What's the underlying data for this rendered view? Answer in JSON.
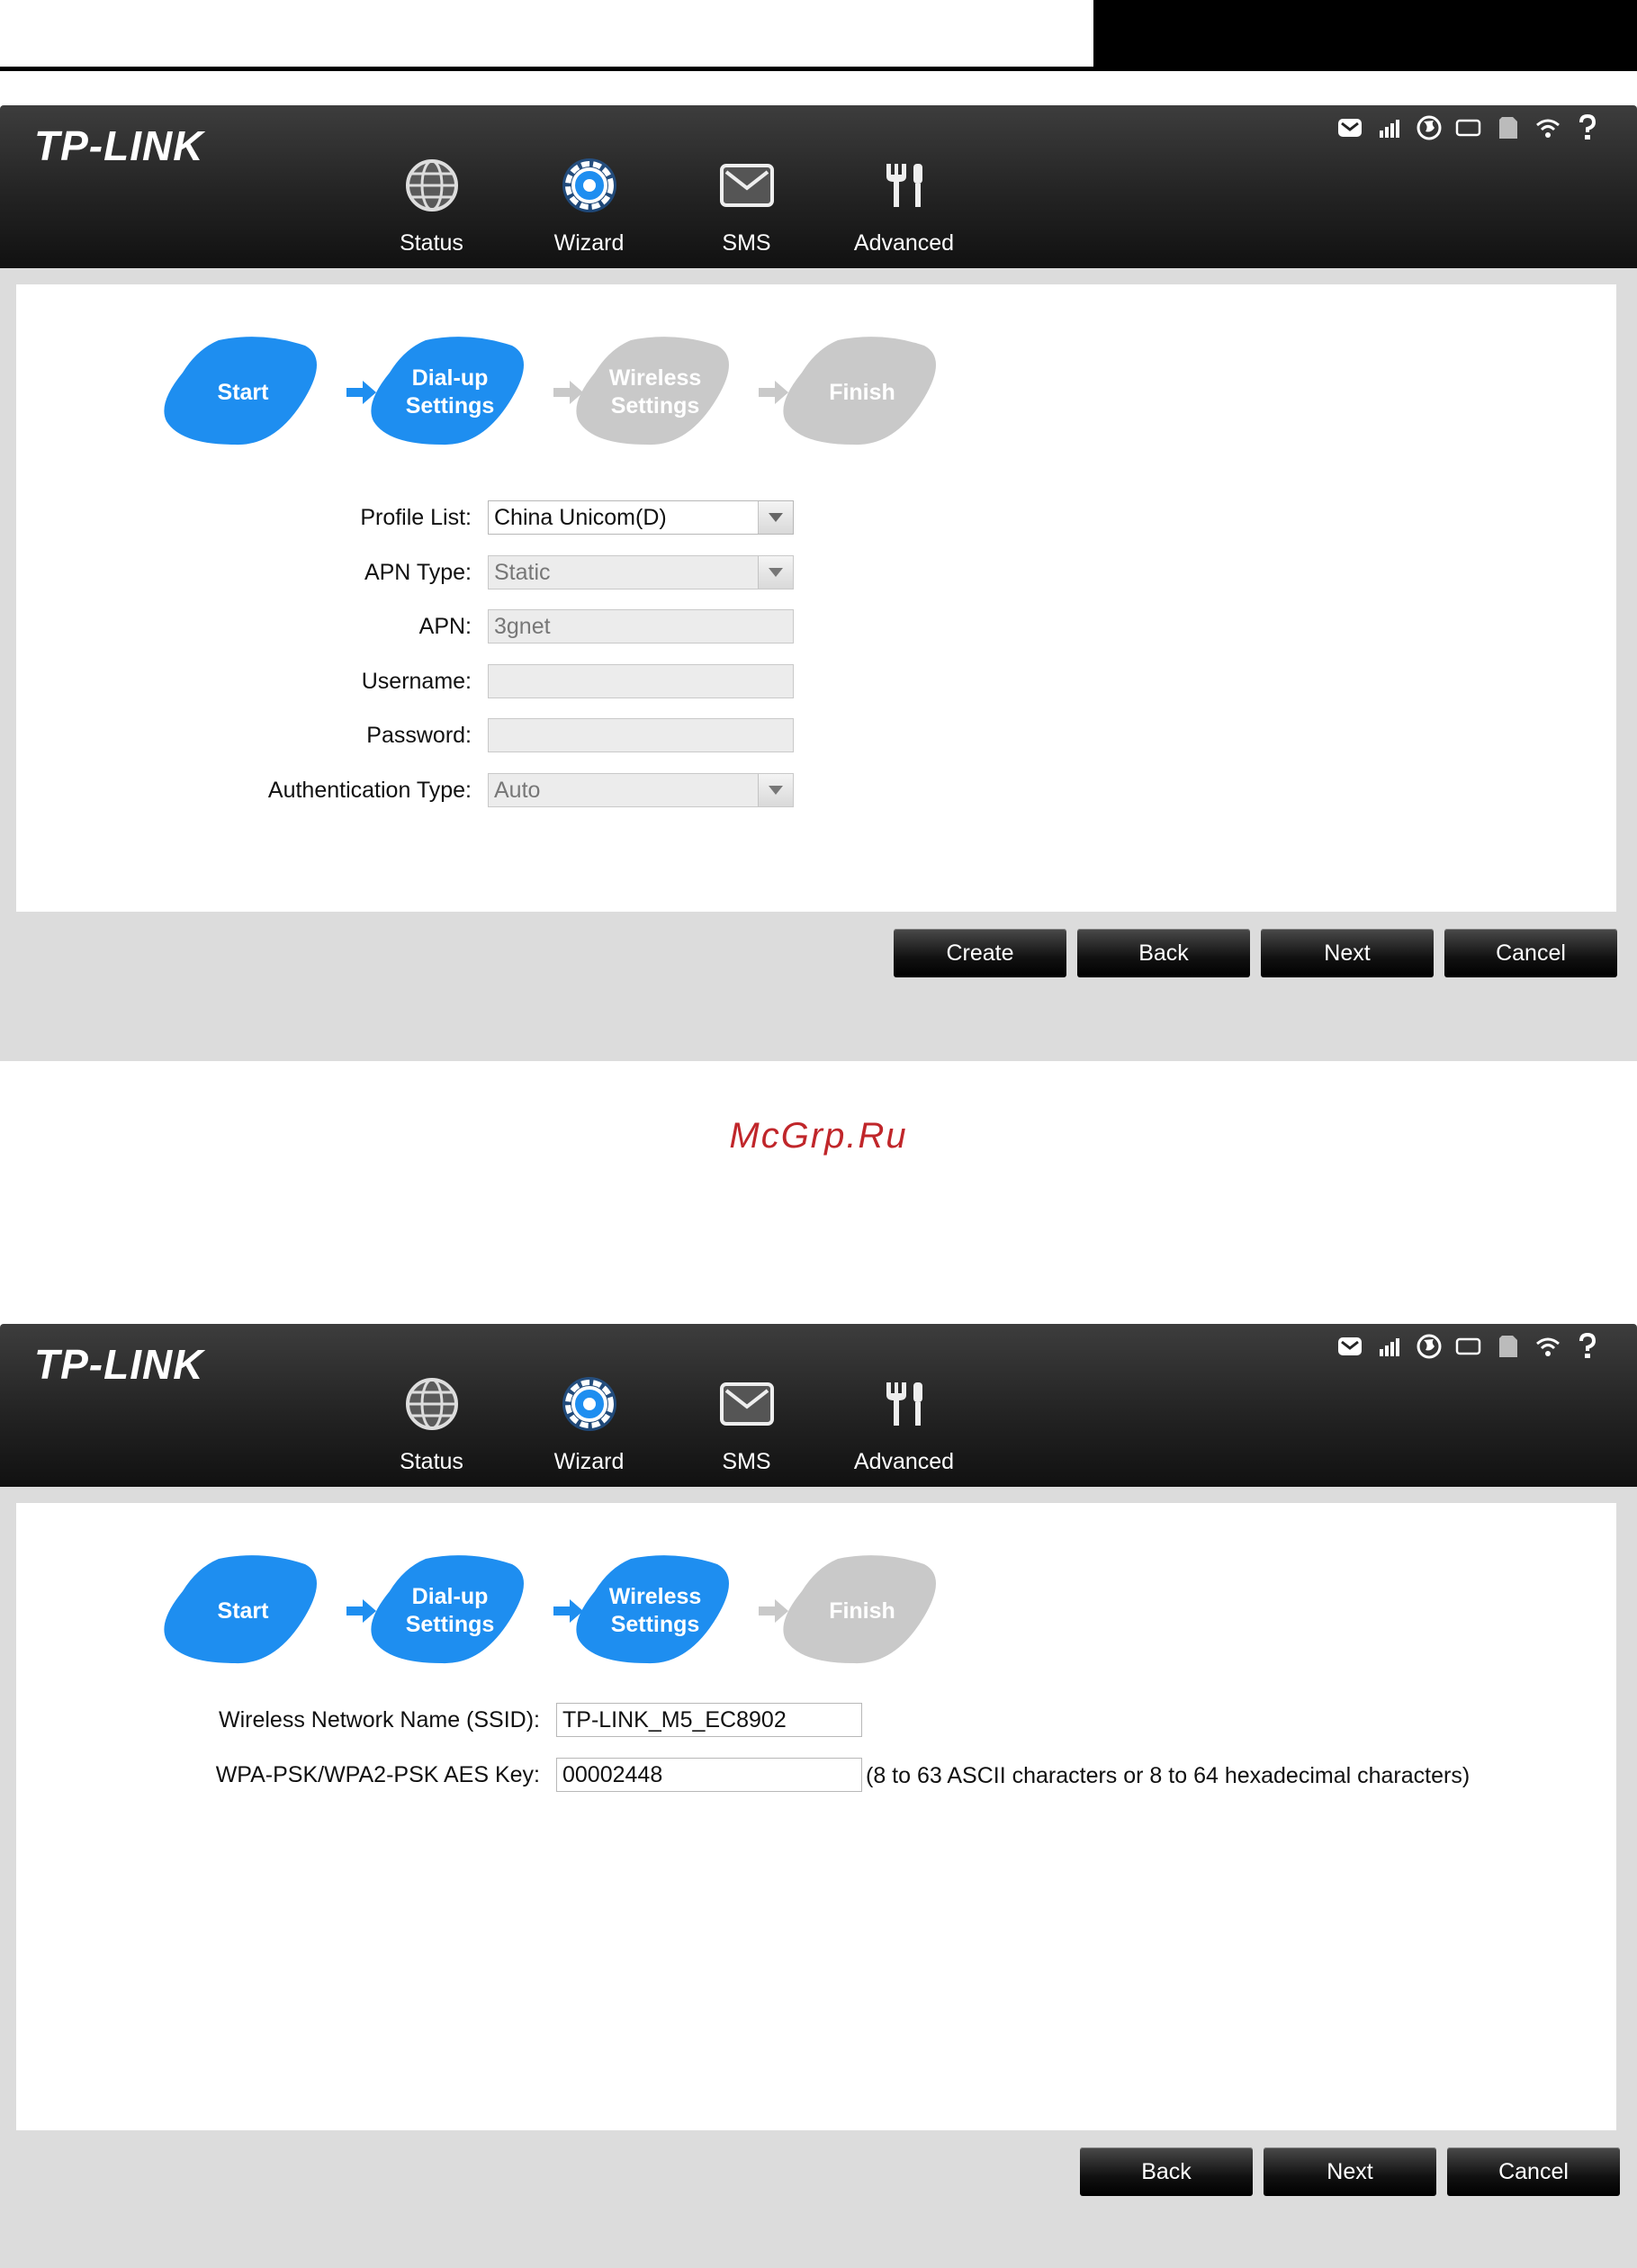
{
  "watermark": "McGrp.Ru",
  "colors": {
    "active_step": "#1e8ef0",
    "inactive_step": "#c9c9c9",
    "topbar": "#1e1e1e"
  },
  "brand": {
    "logo": "TP-LINK"
  },
  "nav": [
    {
      "label": "Status",
      "icon": "globe-icon"
    },
    {
      "label": "Wizard",
      "icon": "gear-icon"
    },
    {
      "label": "SMS",
      "icon": "envelope-icon"
    },
    {
      "label": "Advanced",
      "icon": "tools-icon"
    }
  ],
  "status_icons": [
    "message-icon",
    "signal-icon",
    "internet-icon",
    "battery-icon",
    "sd-card-icon",
    "wifi-icon",
    "help-icon"
  ],
  "steps": [
    {
      "label1": "Start",
      "label2": ""
    },
    {
      "label1": "Dial-up",
      "label2": "Settings"
    },
    {
      "label1": "Wireless",
      "label2": "Settings"
    },
    {
      "label1": "Finish",
      "label2": ""
    }
  ],
  "screen1": {
    "active_steps": 2,
    "form": {
      "profile_list": {
        "label": "Profile List:",
        "value": "China Unicom(D)"
      },
      "apn_type": {
        "label": "APN Type:",
        "value": "Static"
      },
      "apn": {
        "label": "APN:",
        "value": "3gnet"
      },
      "username": {
        "label": "Username:",
        "value": ""
      },
      "password": {
        "label": "Password:",
        "value": ""
      },
      "auth_type": {
        "label": "Authentication Type:",
        "value": "Auto"
      }
    },
    "buttons": {
      "create": "Create",
      "back": "Back",
      "next": "Next",
      "cancel": "Cancel"
    }
  },
  "screen2": {
    "active_steps": 3,
    "form": {
      "ssid": {
        "label": "Wireless Network Name (SSID):",
        "value": "TP-LINK_M5_EC8902"
      },
      "key": {
        "label": "WPA-PSK/WPA2-PSK AES Key:",
        "value": "00002448",
        "hint": "(8 to 63 ASCII characters or 8 to 64 hexadecimal characters)"
      }
    },
    "buttons": {
      "back": "Back",
      "next": "Next",
      "cancel": "Cancel"
    }
  }
}
